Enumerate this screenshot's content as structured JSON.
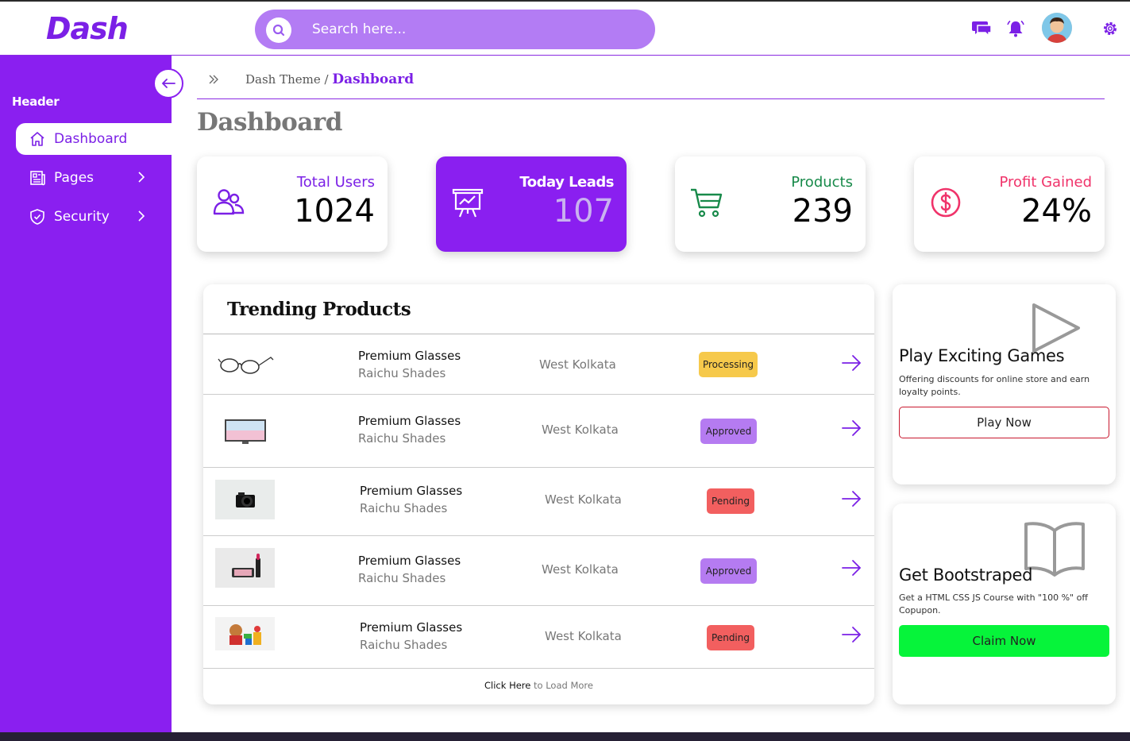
{
  "app": {
    "logo": "Dash"
  },
  "search": {
    "placeholder": "Search here..."
  },
  "topbar": {
    "icons": [
      "chat-icon",
      "bell-icon",
      "avatar",
      "gear-icon"
    ]
  },
  "sidebar": {
    "header": "Header",
    "items": [
      {
        "label": "Dashboard",
        "icon": "home-icon",
        "active": true
      },
      {
        "label": "Pages",
        "icon": "newspaper-icon",
        "active": false
      },
      {
        "label": "Security",
        "icon": "shield-icon",
        "active": false
      }
    ]
  },
  "breadcrumb": {
    "parent": "Dash Theme",
    "separator": " / ",
    "current": "Dashboard"
  },
  "page": {
    "title": "Dashboard"
  },
  "stats": [
    {
      "label": "Total Users",
      "value": "1024",
      "icon": "users-icon",
      "color": "#7b20e6"
    },
    {
      "label": "Today Leads",
      "value": "107",
      "icon": "presentation-chart-icon",
      "color": "#ffffff"
    },
    {
      "label": "Products",
      "value": "239",
      "icon": "cart-icon",
      "color": "#188a4a"
    },
    {
      "label": "Profit Gained",
      "value": "24%",
      "icon": "dollar-icon",
      "color": "#f0336a"
    }
  ],
  "trending": {
    "title": "Trending Products",
    "rows": [
      {
        "image": "glasses",
        "name": "Premium Glasses",
        "brand": "Raichu Shades",
        "location": "West Kolkata",
        "status": "Processing"
      },
      {
        "image": "tv",
        "name": "Premium Glasses",
        "brand": "Raichu Shades",
        "location": "West Kolkata",
        "status": "Approved"
      },
      {
        "image": "camera",
        "name": "Premium Glasses",
        "brand": "Raichu Shades",
        "location": "West Kolkata",
        "status": "Pending"
      },
      {
        "image": "makeup",
        "name": "Premium Glasses",
        "brand": "Raichu Shades",
        "location": "West Kolkata",
        "status": "Approved"
      },
      {
        "image": "toys",
        "name": "Premium Glasses",
        "brand": "Raichu Shades",
        "location": "West Kolkata",
        "status": "Pending"
      }
    ],
    "load_more_link": "Click Here",
    "load_more_rest": " to Load More"
  },
  "promos": [
    {
      "title": "Play Exciting Games",
      "description": "Offering discounts for online store and earn loyalty points.",
      "button": "Play Now",
      "icon": "play-icon"
    },
    {
      "title": "Get Bootstraped",
      "description": "Get a HTML CSS JS Course with \"100 %\" off Copupon.",
      "button": "Claim Now",
      "icon": "book-icon"
    }
  ],
  "colors": {
    "brand": "#8a1ff0",
    "processing": "#f6c94b",
    "approved": "#b57bf1",
    "pending": "#f25f5f",
    "claim": "#06f43a"
  }
}
